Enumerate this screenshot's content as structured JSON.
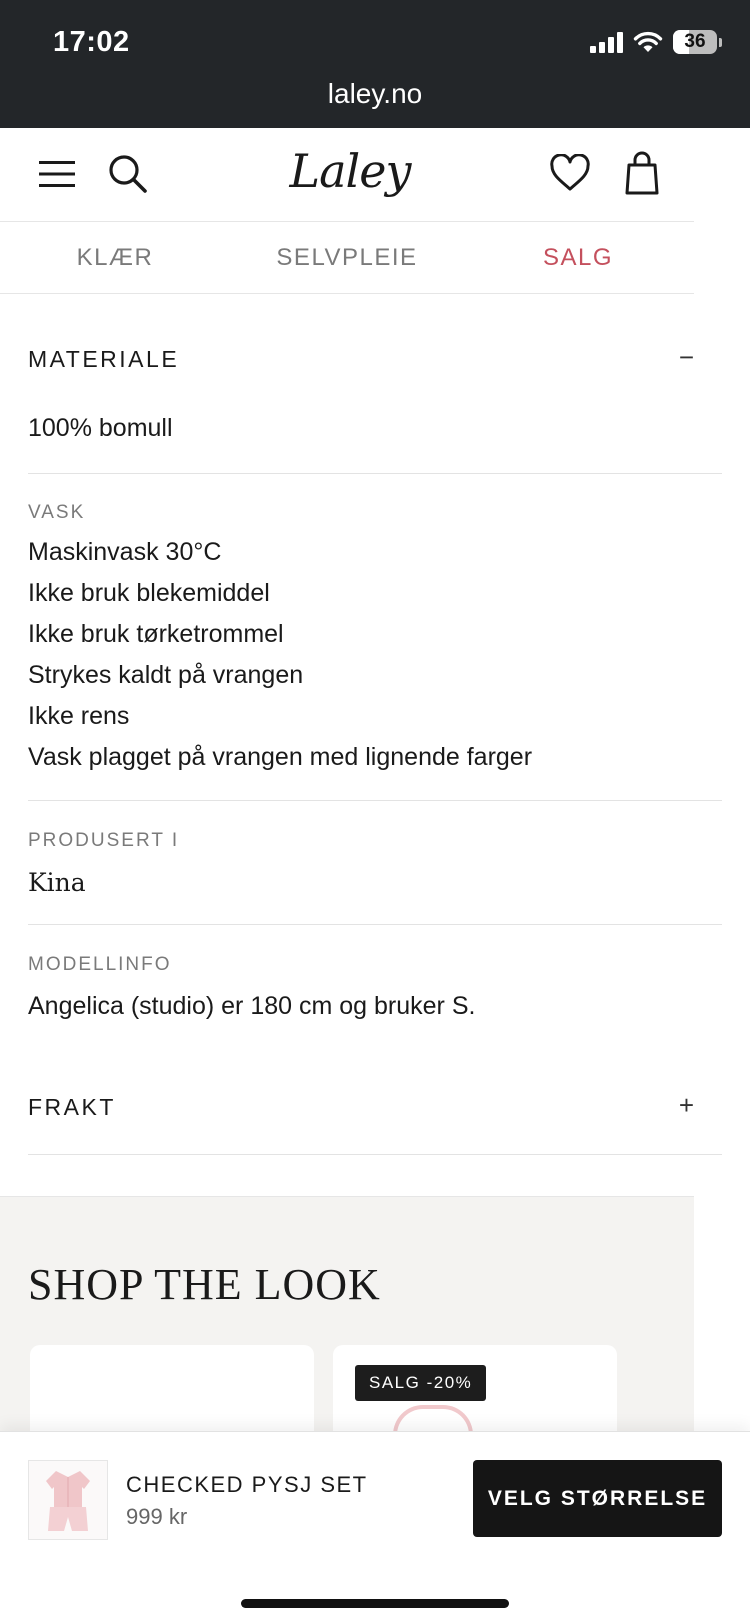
{
  "status_bar": {
    "time": "17:02",
    "battery": "36",
    "url": "laley.no"
  },
  "header": {
    "logo": "Laley"
  },
  "nav": {
    "items": [
      "KLÆR",
      "SELVPLEIE",
      "SALG"
    ]
  },
  "details": {
    "material_title": "MATERIALE",
    "material_toggle": "−",
    "material_text": "100% bomull",
    "wash_label": "VASK",
    "wash_lines": [
      "Maskinvask 30°C",
      "Ikke bruk blekemiddel",
      "Ikke bruk tørketrommel",
      "Strykes kaldt på vrangen",
      "Ikke rens",
      "Vask plagget på vrangen med lignende farger"
    ],
    "origin_label": "PRODUSERT I",
    "origin_value": "Kina",
    "model_label": "MODELLINFO",
    "model_text": "Angelica (studio) er 180 cm og bruker S.",
    "shipping_title": "FRAKT",
    "shipping_toggle": "+"
  },
  "shop_the_look": {
    "title": "SHOP THE LOOK",
    "badge": "SALG -20%"
  },
  "sticky_bar": {
    "product_name": "CHECKED PYSJ SET",
    "price": "999 kr",
    "button_label": "VELG STØRRELSE"
  },
  "colors": {
    "accent_sale": "#c4505d",
    "button_bg": "#151515",
    "status_bg": "#232629"
  }
}
